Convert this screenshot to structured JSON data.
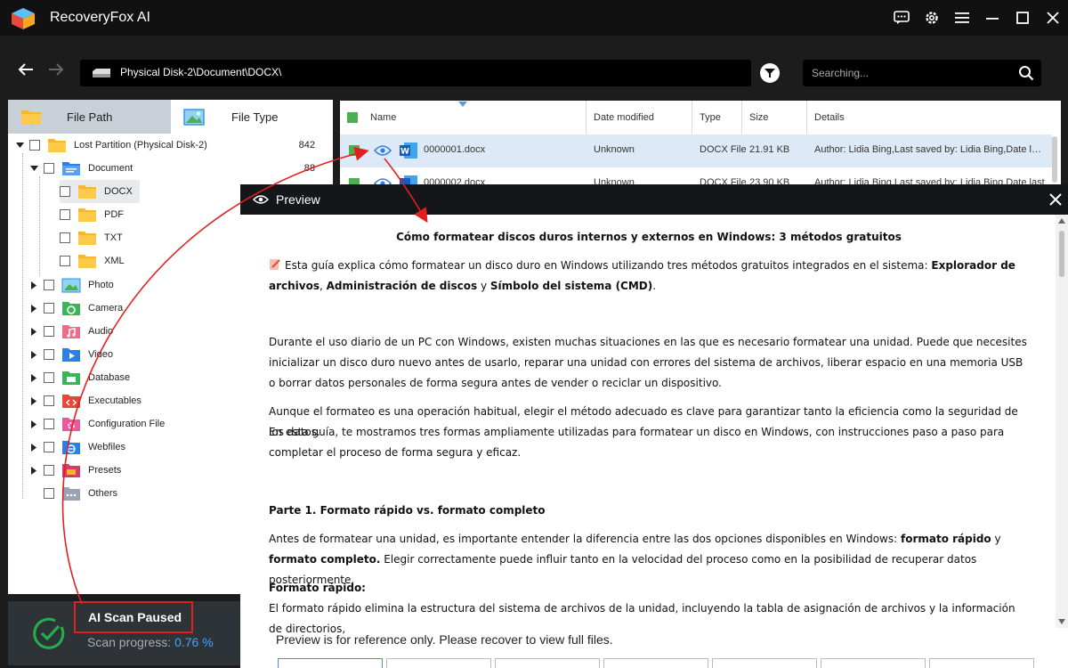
{
  "app": {
    "title": "RecoveryFox AI"
  },
  "navigation": {
    "path": "Physical Disk-2\\Document\\DOCX\\",
    "search_placeholder": "Searching..."
  },
  "tabs": [
    {
      "label": "File Path",
      "icon": "folder-icon"
    },
    {
      "label": "File Type",
      "icon": "image-icon"
    }
  ],
  "tree": {
    "root": {
      "label": "Lost Partition (Physical Disk-2)",
      "count": "842"
    },
    "document": {
      "label": "Document",
      "count": "88"
    },
    "subfolders": [
      "DOCX",
      "PDF",
      "TXT",
      "XML"
    ],
    "categories": [
      "Photo",
      "Camera",
      "Audio",
      "Video",
      "Database",
      "Executables",
      "Configuration File",
      "Webfiles",
      "Presets",
      "Others"
    ]
  },
  "scan": {
    "status": "AI Scan Paused",
    "progress_label": "Scan progress:",
    "progress_value": "0.76 %"
  },
  "table": {
    "columns": [
      "Name",
      "Date modified",
      "Type",
      "Size",
      "Details"
    ],
    "rows": [
      {
        "name": "0000001.docx",
        "date": "Unknown",
        "type": "DOCX File",
        "size": "21.91 KB",
        "details": "Author: Lidia Bing,Last saved by: Lidia Bing,Date last saved"
      },
      {
        "name": "0000002.docx",
        "date": "Unknown",
        "type": "DOCX File",
        "size": "23.90 KB",
        "details": "Author: Lidia Bing,Last saved by: Lidia Bing,Date last saved"
      }
    ]
  },
  "preview": {
    "title": "Preview",
    "doc_title": "Cómo formatear discos duros internos y externos en Windows: 3 métodos gratuitos",
    "intro": "Esta guía explica cómo formatear un disco duro en Windows utilizando tres métodos gratuitos integrados en el sistema: ",
    "intro_b1": "Explorador de archivos",
    "intro_sep1": ", ",
    "intro_b2": "Administración de discos",
    "intro_sep2": " y ",
    "intro_b3": "Símbolo del sistema (CMD)",
    "intro_end": ".",
    "para1": "Durante el uso diario de un PC con Windows, existen muchas situaciones en las que es necesario formatear una unidad. Puede que necesites inicializar un disco duro nuevo antes de usarlo, reparar una unidad con errores del sistema de archivos, liberar espacio en una memoria USB o borrar datos personales de forma segura antes de vender o reciclar un dispositivo.",
    "para2a": "Aunque el formateo es una operación habitual, elegir el método adecuado es clave para garantizar tanto la eficiencia como la seguridad de los datos.",
    "para2b": "En esta guía, te mostramos tres formas ampliamente utilizadas para formatear un disco en Windows, con instrucciones paso a paso para completar el proceso de forma segura y eficaz.",
    "heading1": "Parte 1. Formato rápido vs. formato completo",
    "para3_start": "Antes de formatear una unidad, es importante entender la diferencia entre las dos opciones disponibles en Windows: ",
    "para3_b1": "formato rápido",
    "para3_mid": " y ",
    "para3_b2": "formato completo.",
    "para3_end": " Elegir correctamente puede influir tanto en la velocidad del proceso como en la posibilidad de recuperar datos posteriormente.",
    "heading2": "Formato rápido:",
    "para4": "El formato rápido elimina la estructura del sistema de archivos de la unidad, incluyendo la tabla de asignación de archivos y la información de directorios,",
    "note": "Preview is for reference only. Please recover to view full files."
  },
  "colors": {
    "accent": "#3ea6ff",
    "highlight_red": "#e02020",
    "scan_green": "#22b04a",
    "selected_row": "#dde9f6"
  }
}
